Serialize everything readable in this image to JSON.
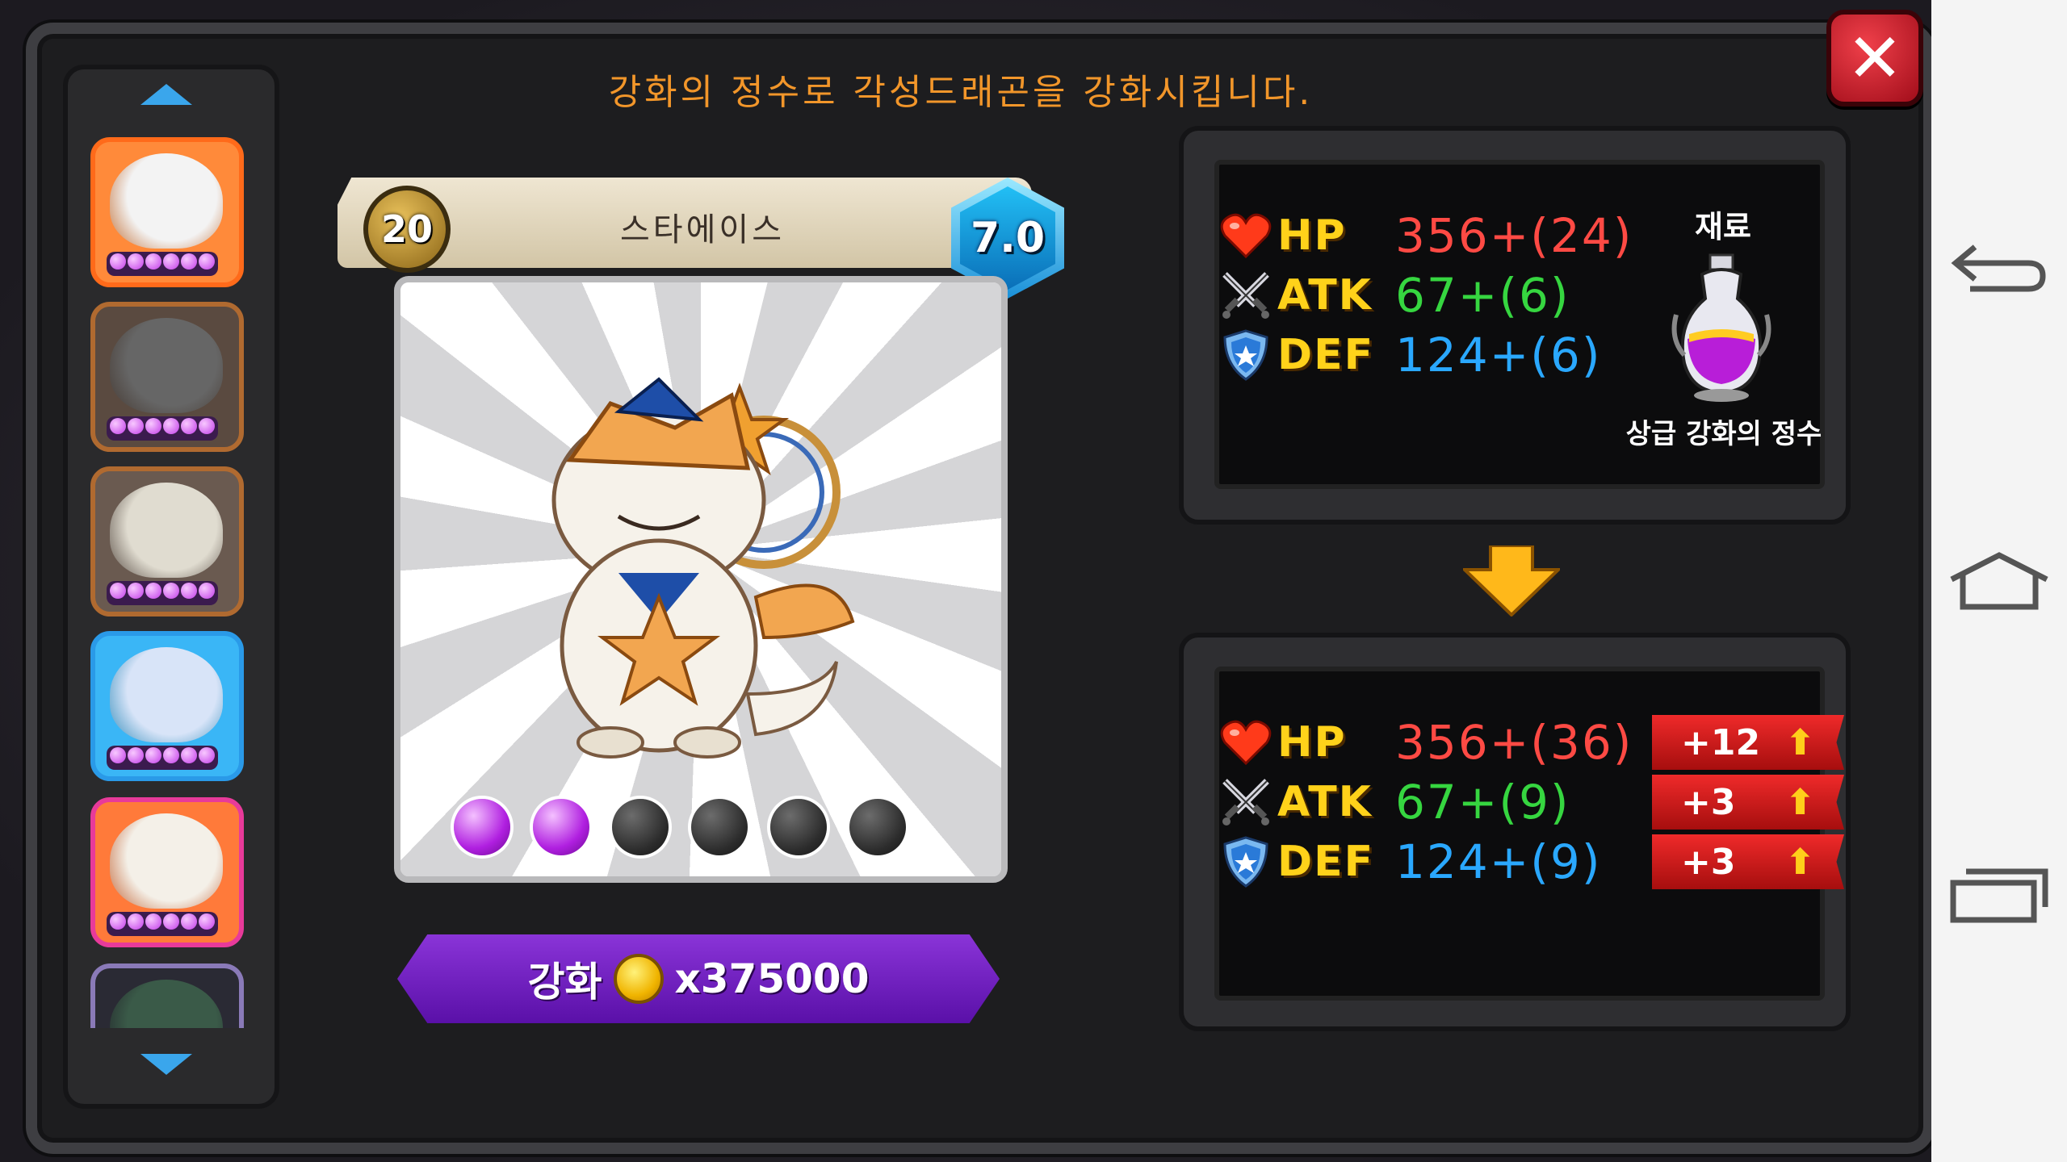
{
  "header": {
    "title": "강화의 정수로 각성드래곤을 강화시킵니다."
  },
  "dragon": {
    "level": "20",
    "name": "스타에이스",
    "grade": "7.0",
    "stars_filled": 2,
    "stars_total": 6
  },
  "enhance_button": {
    "label": "강화",
    "cost": "x375000"
  },
  "current_stats": [
    {
      "icon": "heart-icon",
      "label": "HP",
      "value": "356+(24)",
      "color": "#ff4a44"
    },
    {
      "icon": "crossed-swords-icon",
      "label": "ATK",
      "value": "67+(6)",
      "color": "#36d640"
    },
    {
      "icon": "shield-icon",
      "label": "DEF",
      "value": "124+(6)",
      "color": "#2aa8ff"
    }
  ],
  "material": {
    "title": "재료",
    "name": "상급 강화의 정수",
    "icon": "potion-icon"
  },
  "next_stats": [
    {
      "icon": "heart-icon",
      "label": "HP",
      "value": "356+(36)",
      "gain": "+12"
    },
    {
      "icon": "crossed-swords-icon",
      "label": "ATK",
      "value": "67+(9)",
      "gain": "+3"
    },
    {
      "icon": "shield-icon",
      "label": "DEF",
      "value": "124+(9)",
      "gain": "+3"
    }
  ],
  "sidebar": {
    "thumbs": [
      {
        "border": "#ff6a1a",
        "bg": "#ff8a3a",
        "face": "#f3f3f3"
      },
      {
        "border": "#b06a30",
        "bg": "#5a4a40",
        "face": "#666"
      },
      {
        "border": "#b06a30",
        "bg": "#6a5a50",
        "face": "#e0dcd0"
      },
      {
        "border": "#2a9ae8",
        "bg": "#3ab6f6",
        "face": "#d8e4f8"
      },
      {
        "border": "#e83a9a",
        "bg": "#ff7a3a",
        "face": "#f4f0e8"
      },
      {
        "border": "#8a7ab8",
        "bg": "#2a2a34",
        "face": "#3a5a48"
      }
    ]
  },
  "colors": {
    "title": "#f2962a",
    "stat_label": "#ffd21a",
    "gain_bg": "#d41c1c",
    "enhance_btn": "#7a26c8"
  }
}
